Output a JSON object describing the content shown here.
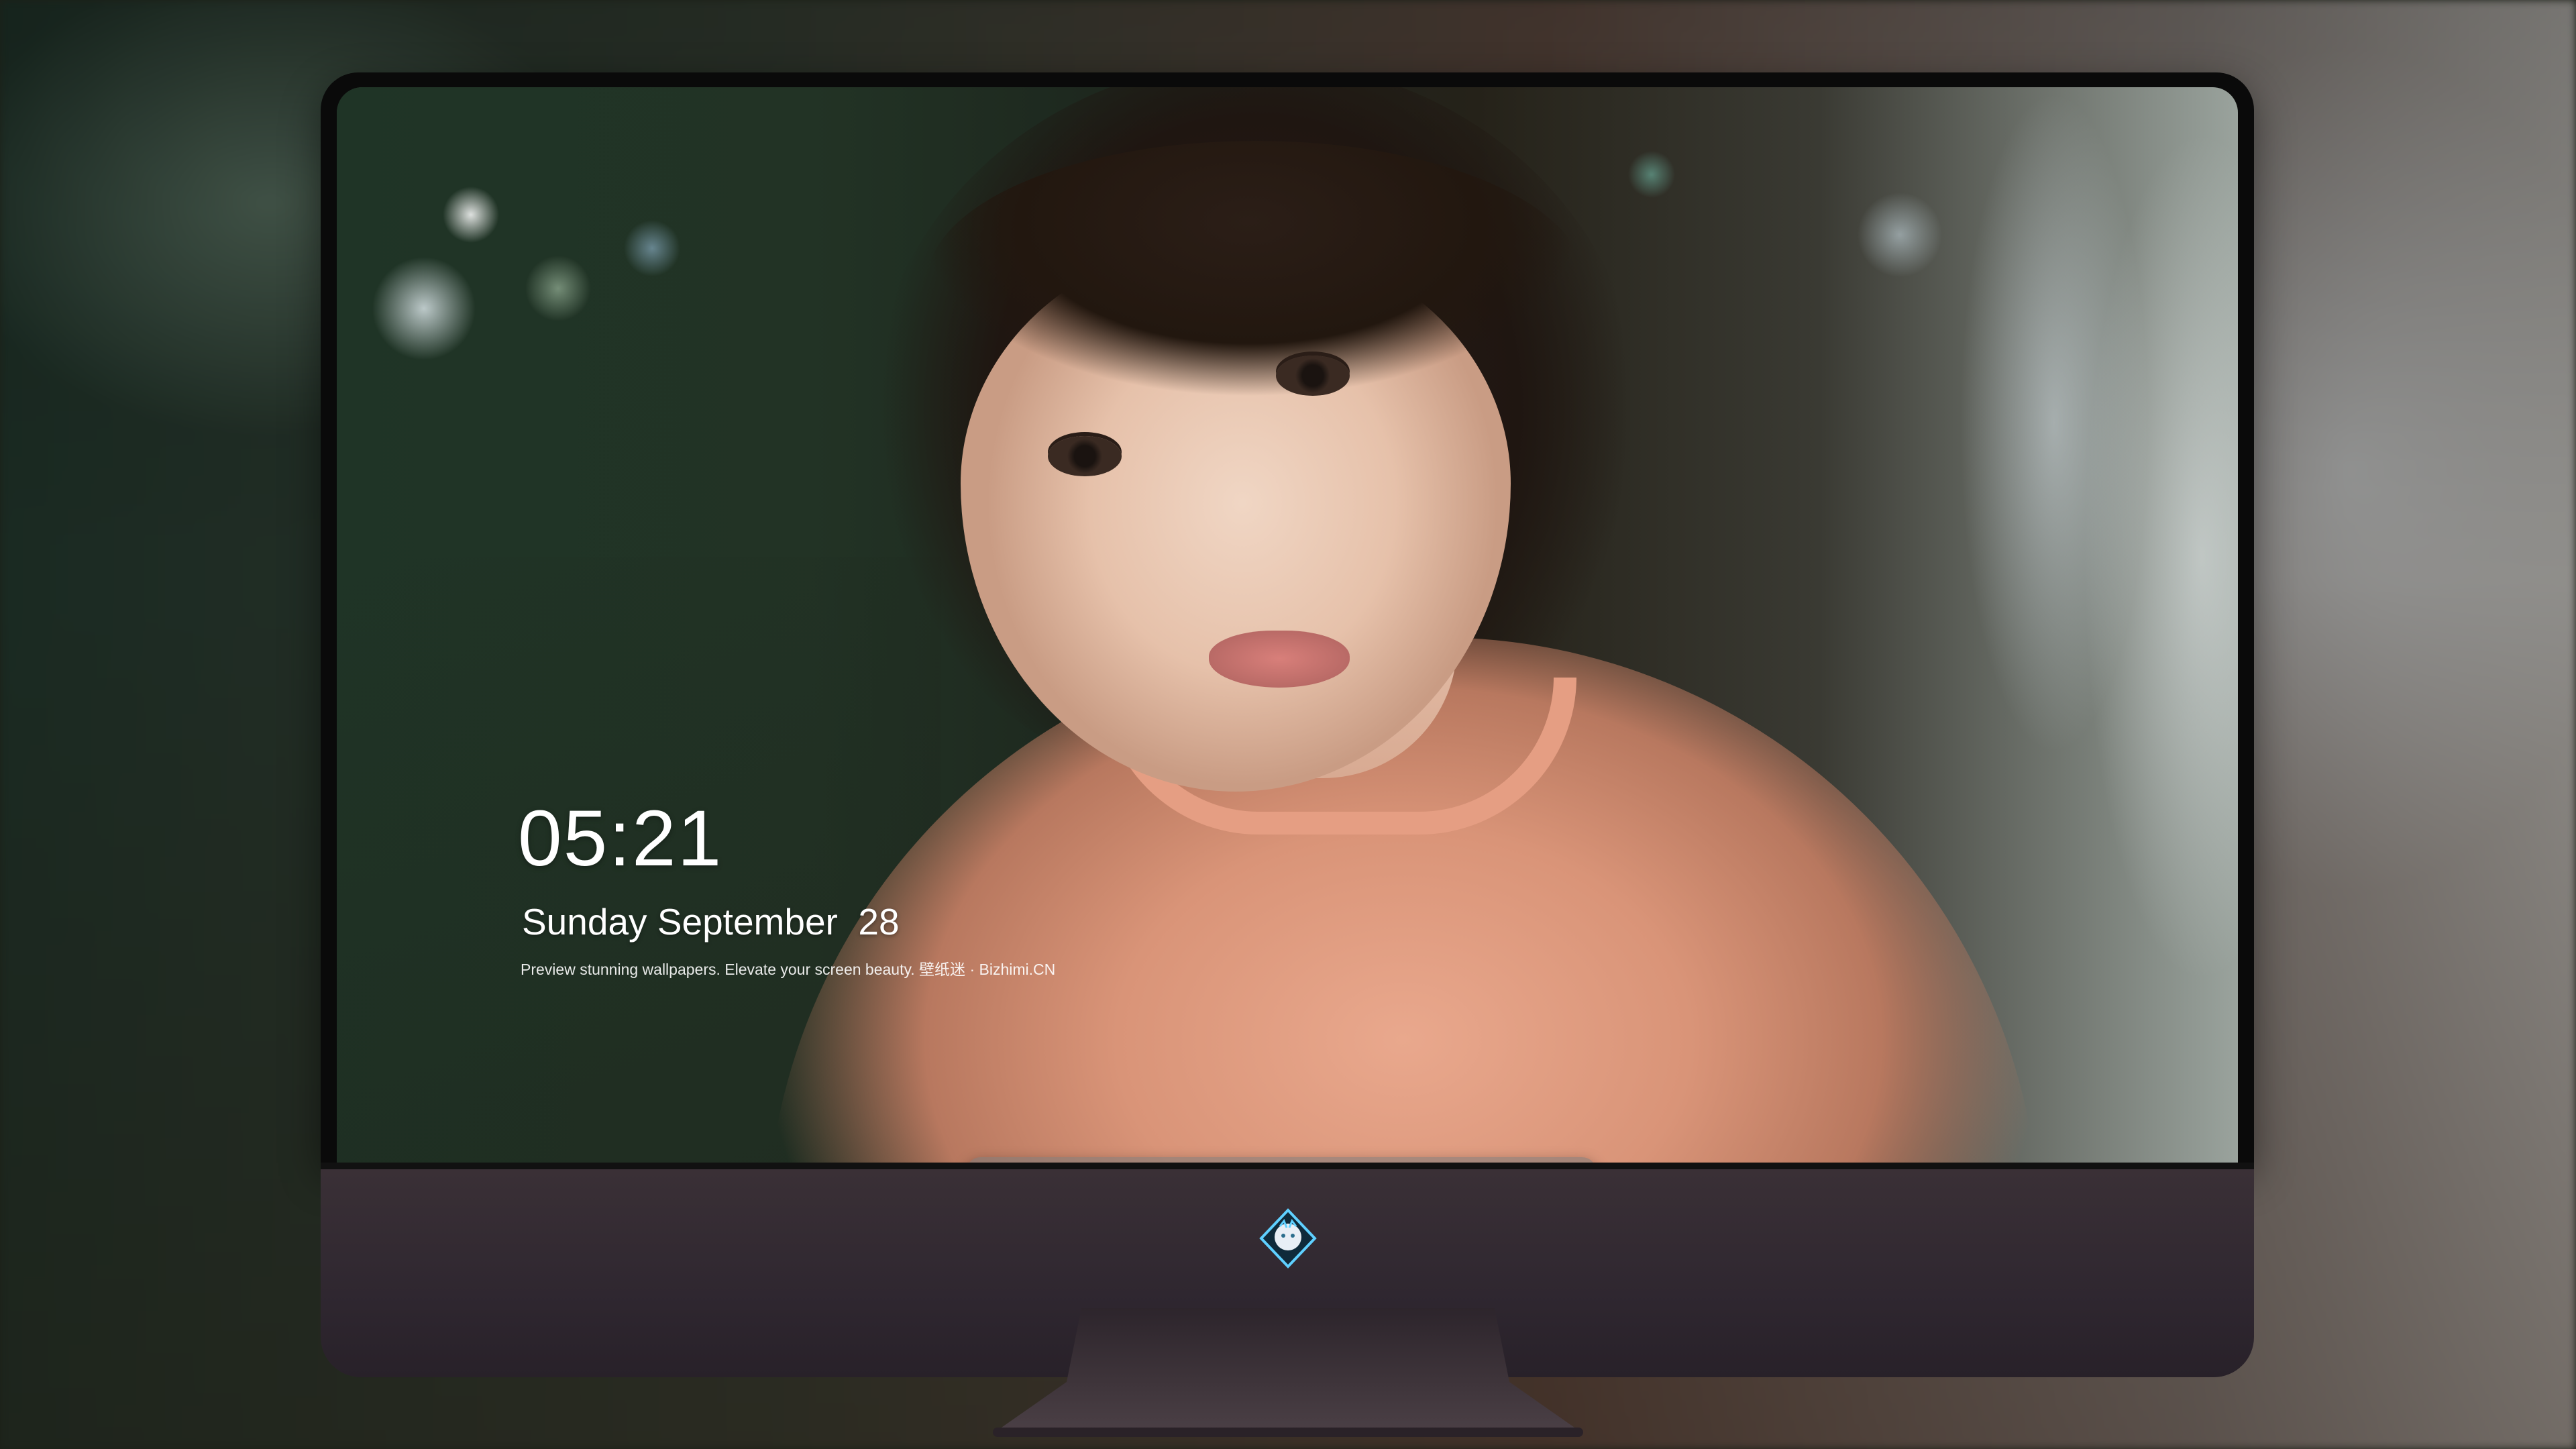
{
  "lockscreen": {
    "time": "05:21",
    "date": "Sunday September  28",
    "tagline": "Preview stunning wallpapers. Elevate your screen beauty. 壁纸迷 · Bizhimi.CN"
  },
  "dock": {
    "apps": [
      {
        "name": "messages-icon"
      },
      {
        "name": "weather-icon"
      },
      {
        "name": "clock-icon"
      },
      {
        "name": "preview-icon"
      },
      {
        "name": "videos-icon"
      },
      {
        "name": "notes-icon"
      },
      {
        "name": "photos-icon"
      }
    ],
    "apps_right": [
      {
        "name": "music-icon"
      },
      {
        "name": "app-store-icon"
      },
      {
        "name": "camera-icon"
      }
    ]
  },
  "branding": {
    "logo": "bizhimi-logo-icon"
  },
  "colors": {
    "bezel": "#0a0a0a",
    "chin": "#2f2730",
    "dock": "rgba(120,120,120,0.55)"
  }
}
